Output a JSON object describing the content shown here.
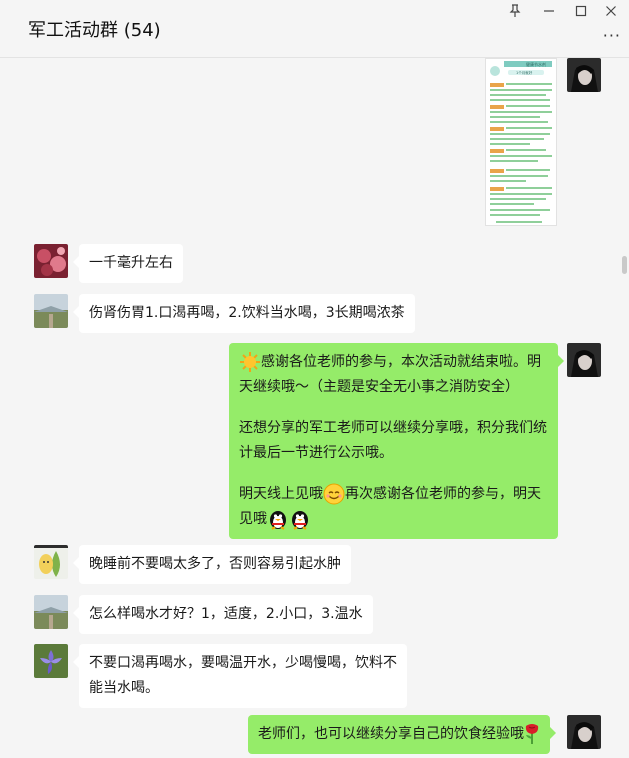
{
  "window": {
    "title": "军工活动群 (54)",
    "controls": {
      "pin": "⚲",
      "minimize": "—",
      "maximize": "☐",
      "close": "✕"
    },
    "more": "···"
  },
  "messages": [
    {
      "from": "self",
      "type": "image",
      "image_label": "健康节水剂",
      "image_sublabel": "1个月就好"
    },
    {
      "from": "other",
      "type": "text",
      "lines": [
        "一千毫升左右"
      ]
    },
    {
      "from": "other",
      "type": "text",
      "lines": [
        "伤肾伤胃1.口渴再喝，2.饮料当水喝，3长期喝浓茶"
      ]
    },
    {
      "from": "self",
      "type": "text",
      "paragraphs": [
        [
          "感谢各位老师的参与，本次活动就结束啦。明",
          "天继续哦～（主题是安全无小事之消防安全）"
        ],
        [
          "还想分享的军工老师可以继续分享哦，积分我们统",
          "计最后一节进行公示哦。"
        ],
        [
          "明天线上见哦",
          "再次感谢各位老师的参与，明天",
          "见哦"
        ]
      ]
    },
    {
      "from": "other",
      "type": "text",
      "lines": [
        "晚睡前不要喝太多了，否则容易引起水肿"
      ]
    },
    {
      "from": "other",
      "type": "text",
      "lines": [
        "怎么样喝水才好？1，适度，2.小口，3.温水"
      ]
    },
    {
      "from": "other",
      "type": "text",
      "lines": [
        "不要口渴再喝水，要喝温开水，少喝慢喝，饮料不",
        "能当水喝。"
      ]
    },
    {
      "from": "self",
      "type": "text",
      "lines": [
        "老师们，也可以继续分享自己的饮食经验哦"
      ]
    }
  ],
  "emojis": [
    "sun-emoji",
    "smile-emoji",
    "penguin-emoji",
    "penguin-emoji",
    "rose-emoji"
  ],
  "colors": {
    "background": "#f5f5f5",
    "self_bubble": "#95ec69",
    "other_bubble": "#ffffff"
  }
}
